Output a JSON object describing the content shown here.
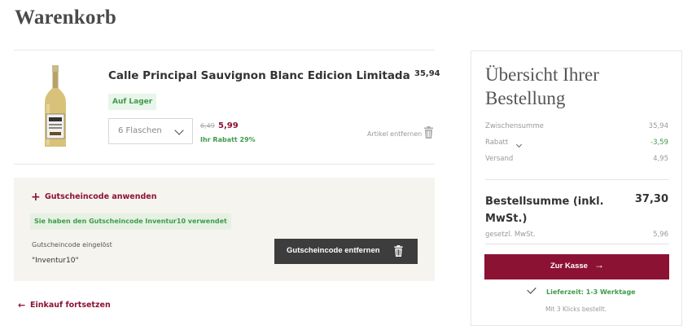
{
  "page": {
    "title": "Warenkorb"
  },
  "cart": {
    "items": [
      {
        "name": "Calle Principal Sauvignon Blanc Edicion Limitada",
        "price": "35,94",
        "stock": "Auf Lager",
        "quantity": "6 Flaschen",
        "old_unit_price": "6,49",
        "unit_price": "5,99",
        "discount": "Ihr Rabatt 29%",
        "remove_label": "Artikel entfernen"
      }
    ]
  },
  "voucher": {
    "apply_label": "Gutscheincode anwenden",
    "applied_message": "Sie haben den Gutscheincode Inventur10 verwendet",
    "redeemed_label": "Gutscheincode eingelöst",
    "code": "\"Inventur10\"",
    "remove_button": "Gutscheincode entfernen"
  },
  "continue_shopping": "Einkauf fortsetzen",
  "summary": {
    "title": "Übersicht Ihrer Bestellung",
    "subtotal_label": "Zwischensumme",
    "subtotal_value": "35,94",
    "discount_label": "Rabatt",
    "discount_value": "-3,59",
    "shipping_label": "Versand",
    "shipping_value": "4,95",
    "total_label": "Bestellsumme (inkl. MwSt.)",
    "total_value": "37,30",
    "vat_label": "gesetzl. MwSt.",
    "vat_value": "5,96",
    "checkout_button": "Zur Kasse",
    "delivery_time": "Lieferzeit: 1-3 Werktage",
    "clicks_note": "Mit 3 Klicks bestellt."
  },
  "colors": {
    "accent": "#8c1233",
    "success": "#3f9b4b",
    "dark_button": "#3d3d3d",
    "voucher_bg": "#f6f4ef"
  },
  "icons": [
    "bottle-image",
    "chevron-down-icon",
    "trash-icon",
    "plus-icon",
    "arrow-left-icon",
    "arrow-right-icon",
    "checkmark-icon"
  ]
}
